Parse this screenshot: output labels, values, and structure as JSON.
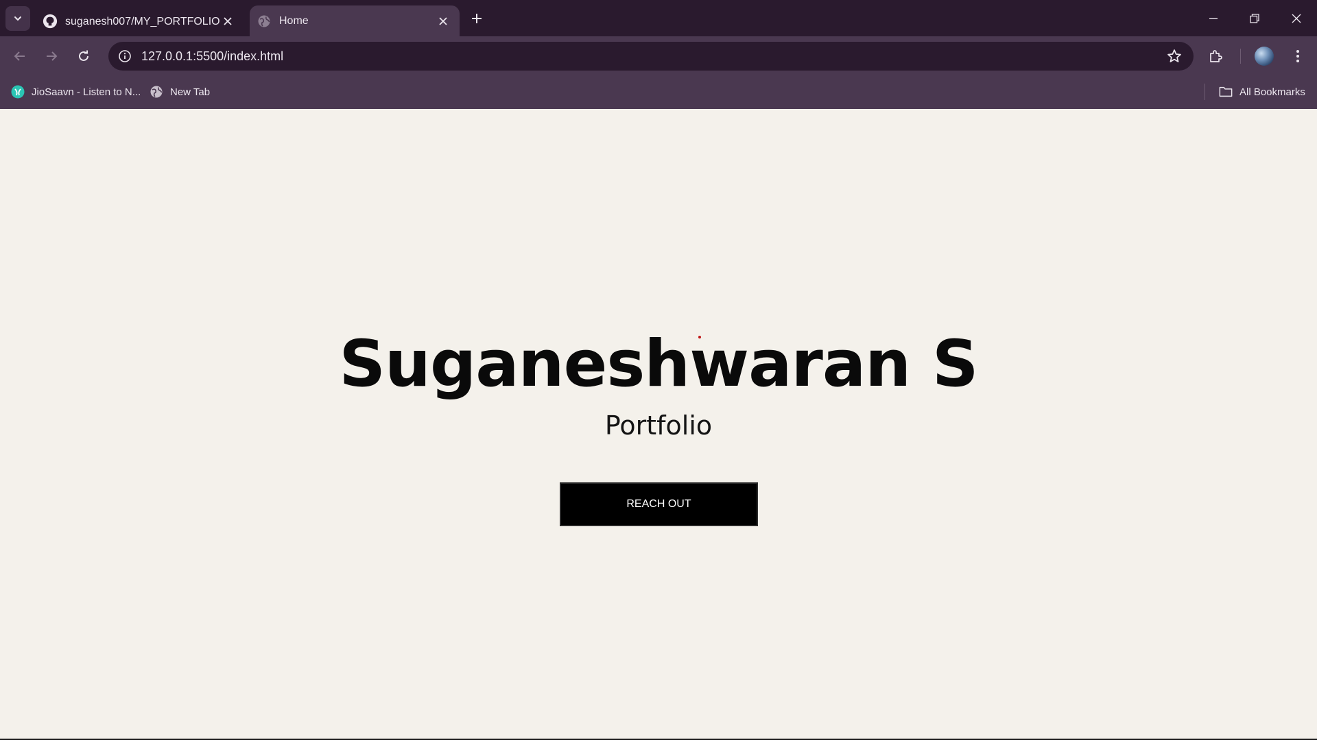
{
  "tabs": [
    {
      "title": "suganesh007/MY_PORTFOLIO: 💻",
      "favicon": "github-icon",
      "active": false
    },
    {
      "title": "Home",
      "favicon": "globe-icon",
      "active": true
    }
  ],
  "toolbar": {
    "url": "127.0.0.1:5500/index.html"
  },
  "bookmarks": {
    "items": [
      {
        "label": "JioSaavn - Listen to N...",
        "icon": "jiosaavn-icon"
      },
      {
        "label": "New Tab",
        "icon": "globe-icon"
      }
    ],
    "all_bookmarks_label": "All Bookmarks"
  },
  "page": {
    "title": "Suganeshwaran S",
    "subtitle": "Portfolio",
    "cta_label": "REACH OUT"
  },
  "colors": {
    "tab_strip": "#2a1a2e",
    "toolbar": "#4a3850",
    "page_background": "#f4f1eb",
    "button_background": "#000000",
    "jiosaavn_accent": "#2bc5b4"
  }
}
